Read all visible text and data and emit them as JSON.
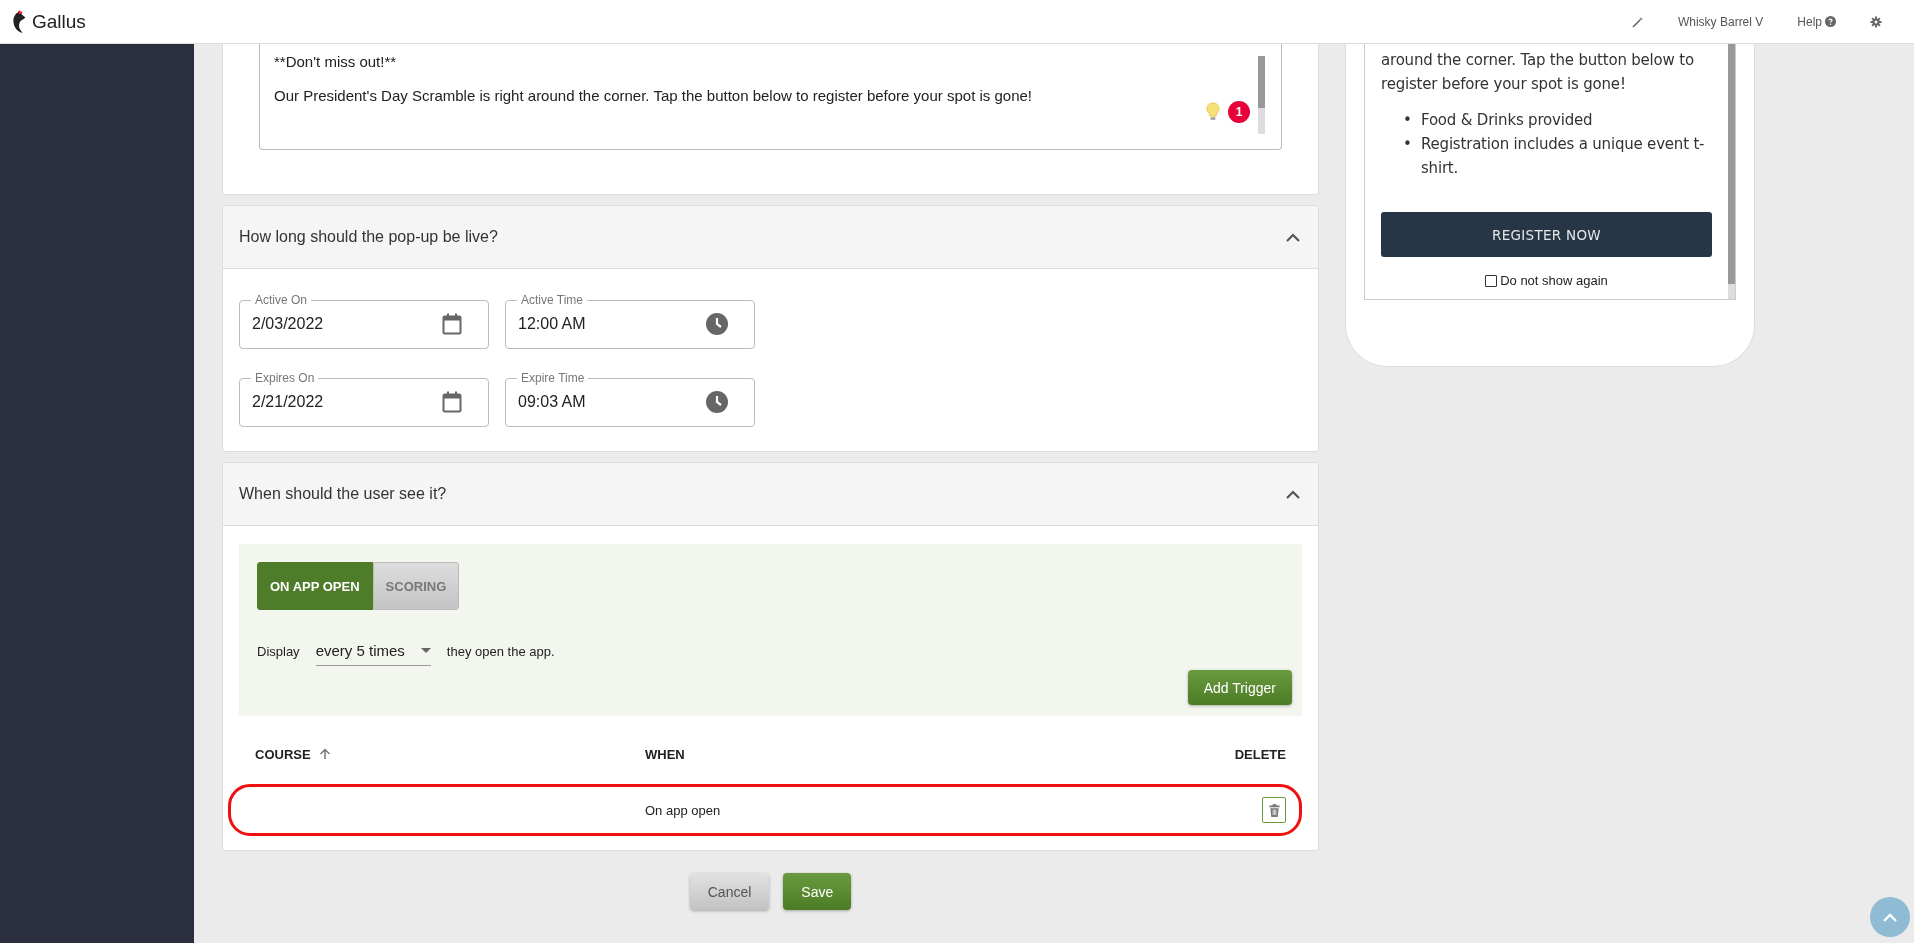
{
  "top_bar": {
    "brand": "Gallus",
    "account": "Whisky Barrel V",
    "help": "Help"
  },
  "message": {
    "lines": [
      "**Don't miss out!**",
      "Our President's Day Scramble is right around the corner. Tap the button below to register before your spot is gone!"
    ],
    "issue_count": "1"
  },
  "schedule": {
    "title": "How long should the pop-up be live?",
    "expanded": true,
    "fields": [
      {
        "label": "Active On",
        "value": "2/03/2022",
        "kind": "date"
      },
      {
        "label": "Active Time",
        "value": "12:00 AM",
        "kind": "time"
      },
      {
        "label": "Expires On",
        "value": "2/21/2022",
        "kind": "date"
      },
      {
        "label": "Expire Time",
        "value": "09:03 AM",
        "kind": "time"
      }
    ]
  },
  "triggers": {
    "title": "When should the user see it?",
    "expanded": true,
    "modes": [
      {
        "label": "ON APP OPEN",
        "selected": true
      },
      {
        "label": "SCORING",
        "selected": false
      }
    ],
    "display_prefix": "Display",
    "frequency": "every 5 times",
    "display_suffix": "they open the app.",
    "add_button": "Add Trigger",
    "columns": [
      "COURSE",
      "WHEN",
      "DELETE"
    ],
    "rows": [
      {
        "when": "On app open",
        "highlighted": true
      }
    ]
  },
  "actions": [
    "Cancel",
    "Save"
  ],
  "preview": {
    "paragraph": "around the corner. Tap the button below to register before your spot is gone!",
    "bullets": [
      {
        "marker": "•",
        "text": "Food & Drinks provided"
      },
      {
        "marker": "•",
        "text": "Registration includes a unique event t-shirt."
      }
    ],
    "button": "REGISTER NOW",
    "dont_show": {
      "label": "Do not show again",
      "checked": false
    }
  }
}
